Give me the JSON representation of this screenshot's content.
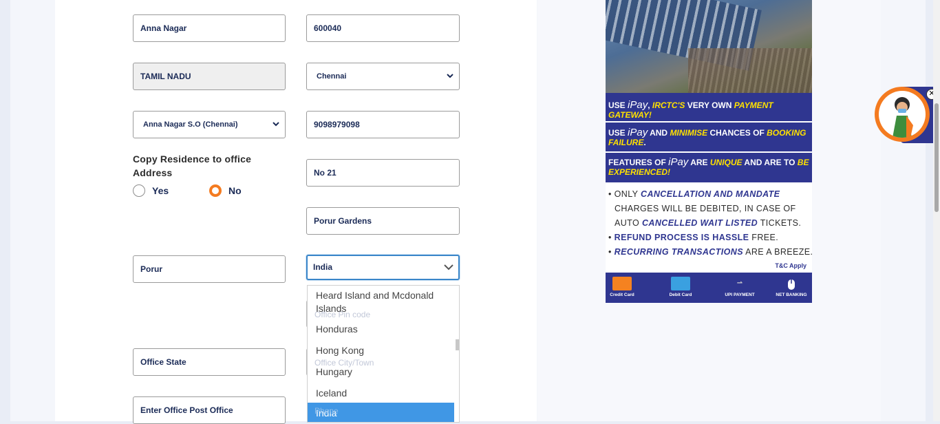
{
  "form": {
    "residence_area": "Anna Nagar",
    "residence_pin": "600040",
    "residence_state": "TAMIL NADU",
    "residence_city": "Chennai",
    "residence_post_office": "Anna Nagar S.O (Chennai)",
    "phone": "9098979098",
    "copy_label": "Copy Residence to office Address",
    "radio_yes": "Yes",
    "radio_no": "No",
    "office_flat": "No 21",
    "office_street": "Porur Gardens",
    "office_area": "Porur",
    "office_country": "India",
    "office_pin_placeholder": "Office Pin code",
    "office_state": "Office State",
    "office_city_placeholder": "Office City/Town",
    "office_post_office": "Enter Office Post Office",
    "phone_placeholder": "Phone"
  },
  "country_dropdown": {
    "options": [
      "Heard Island and Mcdonald Islands",
      "Honduras",
      "Hong Kong",
      "Hungary",
      "Iceland",
      "India"
    ],
    "selected": "India"
  },
  "ad": {
    "band1_a": "USE ",
    "ipay": "iPay",
    "band1_b": ", ",
    "band1_em1": "IRCTC'S",
    "band1_c": " VERY OWN ",
    "band1_em2": "PAYMENT GATEWAY!",
    "band2_a": "USE ",
    "band2_b": " AND ",
    "band2_em1": "MINIMISE",
    "band2_c": " CHANCES OF ",
    "band2_em2": "BOOKING FAILURE",
    "band2_d": ".",
    "band3_a": "FEATURES OF ",
    "band3_b": " ARE ",
    "band3_em1": "UNIQUE",
    "band3_c": " AND ARE TO ",
    "band3_em2": "BE EXPERIENCED!",
    "l1_a": "• ONLY ",
    "l1_b": "CANCELLATION AND MANDATE",
    "l2": "CHARGES WILL BE DEBITED, IN CASE OF",
    "l3_a": "AUTO ",
    "l3_b": "CANCELLED WAIT LISTED",
    "l3_c": " TICKETS.",
    "l4_a": "• ",
    "l4_b": "REFUND PROCESS IS HASSLE",
    "l4_c": " FREE.",
    "l5_a": "• ",
    "l5_b": "RECURRING TRANSACTIONS",
    "l5_c": " ARE A BREEZE.",
    "tc": "T&C Apply",
    "payments": [
      "Credit Card",
      "Debit Card",
      "UPI PAYMENT",
      "NET BANKING"
    ]
  },
  "colors": {
    "accent_orange": "#f47b20",
    "ad_blue": "#2f3690",
    "ad_yellow": "#ffe100",
    "dropdown_selected": "#4097e5"
  }
}
